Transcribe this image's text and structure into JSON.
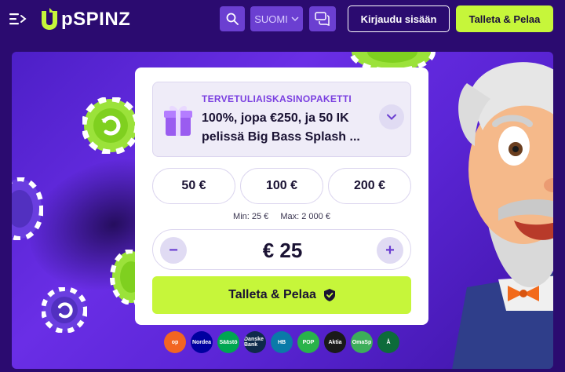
{
  "header": {
    "logo": "upSPINZ",
    "logo_u": "u",
    "logo_rest": "pSPINZ",
    "language": "SUOMI",
    "login_label": "Kirjaudu sisään",
    "deposit_label": "Talleta & Pelaa",
    "icons": [
      "menu-icon",
      "search-icon",
      "chevron-down-icon",
      "chat-icon"
    ]
  },
  "promo": {
    "label": "TERVETULIAISKASINOPAKETTI",
    "text": "100%, jopa €250, ja 50 IK pelissä Big Bass Splash ...",
    "icon": "gift-icon"
  },
  "amounts": [
    "50 €",
    "100 €",
    "200 €"
  ],
  "limits": {
    "min": "Min: 25 €",
    "max": "Max: 2 000 €"
  },
  "stepper": {
    "minus": "−",
    "plus": "+",
    "value": "€ 25"
  },
  "play_button": {
    "label": "Talleta & Pelaa",
    "icon": "shield-check-icon"
  },
  "payment_methods": [
    {
      "name": "op",
      "label": "op",
      "color": "#f26522"
    },
    {
      "name": "nordea",
      "label": "Nordea",
      "color": "#0000a0"
    },
    {
      "name": "saastopankki",
      "label": "Säästö",
      "color": "#00a651"
    },
    {
      "name": "danske",
      "label": "Danske Bank",
      "color": "#0f2a4a"
    },
    {
      "name": "handelsbanken",
      "label": "HB",
      "color": "#0a7aa8"
    },
    {
      "name": "pop",
      "label": "POP",
      "color": "#29b34a"
    },
    {
      "name": "aktia",
      "label": "Aktia",
      "color": "#1a1a1a"
    },
    {
      "name": "omasp",
      "label": "OmaSp",
      "color": "#3cae5a"
    },
    {
      "name": "alandsbanken",
      "label": "Å",
      "color": "#0d6b3a"
    }
  ],
  "colors": {
    "background": "#2b0b70",
    "accent": "#c6f63a",
    "purple": "#6b3fd1",
    "promo_label": "#7a3fe0"
  }
}
